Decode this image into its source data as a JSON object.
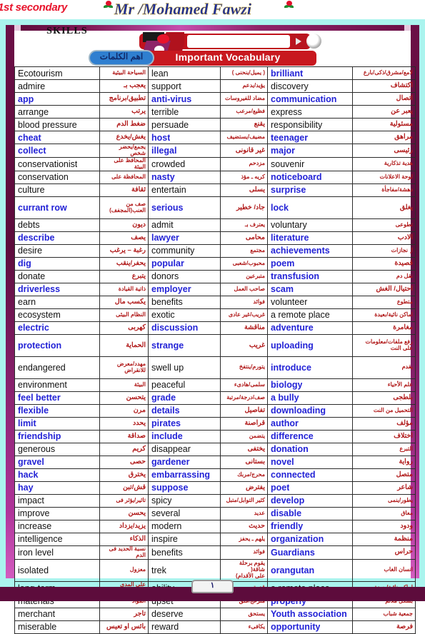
{
  "header": {
    "grade_label": "1st secondary",
    "teacher_name": "Mr /Mohamed Fawzi",
    "skills_label": "SKILLS",
    "vocabulary_label": "Important Vocabulary",
    "vocabulary_label_arabic": "اهم الكلمات"
  },
  "footer": {
    "page_number": "١"
  },
  "colors": {
    "english_blue": "#2323d6",
    "english_black": "#111111",
    "arabic_red": "#b01818",
    "banner_red": "#c8181f",
    "frame_cyan": "#aaf4ee",
    "band_purple": "#5d0c3c",
    "grade_red": "#e8142c",
    "teacher_blue": "#1d2f9e"
  },
  "table": {
    "rows": [
      {
        "h": "s",
        "c1": {
          "en": "Ecotourism",
          "style": "black",
          "ar": "السياحة البيئية",
          "ar_size": "tiny"
        },
        "c2": {
          "en": "lean",
          "style": "black",
          "ar": "( يميل/ينحنى )",
          "ar_size": "tiny"
        },
        "c3": {
          "en": "brilliant",
          "style": "blue",
          "ar": "لامع/مشرق/ذكى/بارع",
          "ar_size": "tiny"
        }
      },
      {
        "h": "s",
        "c1": {
          "en": "admire",
          "style": "black",
          "ar": "يعجب بـ",
          "ar_size": ""
        },
        "c2": {
          "en": "support",
          "style": "black",
          "ar": "يؤيد/يدعم",
          "ar_size": "tiny"
        },
        "c3": {
          "en": "discovery",
          "style": "black",
          "ar": "اكتشاف",
          "ar_size": ""
        }
      },
      {
        "h": "s",
        "c1": {
          "en": "app",
          "style": "blue",
          "ar": "تطبيق/برنامج",
          "ar_size": ""
        },
        "c2": {
          "en": "anti-virus",
          "style": "blue",
          "ar": "مضاد للفيروسات",
          "ar_size": "tiny"
        },
        "c3": {
          "en": "communication",
          "style": "blue",
          "ar": "اتصال",
          "ar_size": ""
        }
      },
      {
        "h": "s",
        "c1": {
          "en": "arrange",
          "style": "black",
          "ar": "يرتب",
          "ar_size": ""
        },
        "c2": {
          "en": "terrible",
          "style": "black",
          "ar": "فظيع/مرعب",
          "ar_size": "tiny"
        },
        "c3": {
          "en": "express",
          "style": "black",
          "ar": "يعبر عن",
          "ar_size": ""
        }
      },
      {
        "h": "s",
        "c1": {
          "en": "blood pressure",
          "style": "black",
          "ar": "ضغط الدم",
          "ar_size": ""
        },
        "c2": {
          "en": "persuade",
          "style": "black",
          "ar": "يقنع",
          "ar_size": ""
        },
        "c3": {
          "en": "responsibility",
          "style": "black",
          "ar": "مسئولية",
          "ar_size": ""
        }
      },
      {
        "h": "s",
        "c1": {
          "en": "cheat",
          "style": "blue",
          "ar": "يغش/يخدع",
          "ar_size": ""
        },
        "c2": {
          "en": "host",
          "style": "blue",
          "ar": "مضيف/يستضيف",
          "ar_size": "tiny"
        },
        "c3": {
          "en": "teenager",
          "style": "blue",
          "ar": "مراهق",
          "ar_size": ""
        }
      },
      {
        "h": "s",
        "c1": {
          "en": "collect",
          "style": "blue",
          "ar": "يجمع/يحضر شخص",
          "ar_size": "tiny"
        },
        "c2": {
          "en": "illegal",
          "style": "blue",
          "ar": "غير قانونى",
          "ar_size": ""
        },
        "c3": {
          "en": "major",
          "style": "blue",
          "ar": "رئيسى",
          "ar_size": ""
        }
      },
      {
        "h": "s",
        "c1": {
          "en": "conservationist",
          "style": "black",
          "ar": "المحافظ على البيئة",
          "ar_size": "tiny"
        },
        "c2": {
          "en": "crowded",
          "style": "black",
          "ar": "مزدحم",
          "ar_size": "tiny"
        },
        "c3": {
          "en": "souvenir",
          "style": "black",
          "ar": "هدية تذكارية",
          "ar_size": "tiny"
        }
      },
      {
        "h": "s",
        "c1": {
          "en": "conservation",
          "style": "black",
          "ar": "المحافظة على",
          "ar_size": "tiny"
        },
        "c2": {
          "en": "nasty",
          "style": "blue",
          "ar": "كريه ـ مؤذ",
          "ar_size": "tiny"
        },
        "c3": {
          "en": "noticeboard",
          "style": "blue",
          "ar": "لوحة الاعلانات",
          "ar_size": "tiny"
        }
      },
      {
        "h": "s",
        "c1": {
          "en": "culture",
          "style": "black",
          "ar": "ثقافة",
          "ar_size": ""
        },
        "c2": {
          "en": "entertain",
          "style": "black",
          "ar": "يسلى",
          "ar_size": ""
        },
        "c3": {
          "en": "surprise",
          "style": "blue",
          "ar": "دهشة/مفاجأة",
          "ar_size": "tiny"
        }
      },
      {
        "h": "t",
        "c1": {
          "en": "currant row",
          "style": "blue",
          "ar": "صف من\nالعنب(المجفف)",
          "ar_size": "tiny"
        },
        "c2": {
          "en": "serious",
          "style": "blue",
          "ar": "جاد/ خطير",
          "ar_size": ""
        },
        "c3": {
          "en": "lock",
          "style": "blue",
          "ar": "يغلق",
          "ar_size": ""
        }
      },
      {
        "h": "s",
        "c1": {
          "en": "debts",
          "style": "black",
          "ar": "ديون",
          "ar_size": ""
        },
        "c2": {
          "en": "admit",
          "style": "black",
          "ar": "يعترف بـ",
          "ar_size": "tiny"
        },
        "c3": {
          "en": "voluntary",
          "style": "black",
          "ar": "تطوعى",
          "ar_size": "tiny"
        }
      },
      {
        "h": "s",
        "c1": {
          "en": "describe",
          "style": "blue",
          "ar": "يصف",
          "ar_size": ""
        },
        "c2": {
          "en": "lawyer",
          "style": "blue",
          "ar": "محامى",
          "ar_size": ""
        },
        "c3": {
          "en": "literature",
          "style": "blue",
          "ar": "الادب",
          "ar_size": ""
        }
      },
      {
        "h": "s",
        "c1": {
          "en": "desire",
          "style": "black",
          "ar": "رغبة – يرغب",
          "ar_size": ""
        },
        "c2": {
          "en": "community",
          "style": "black",
          "ar": "مجتمع",
          "ar_size": "tiny"
        },
        "c3": {
          "en": "achievements",
          "style": "blue",
          "ar": "ا ٕ نجازات",
          "ar_size": "tiny"
        }
      },
      {
        "h": "s",
        "c1": {
          "en": "dig",
          "style": "blue",
          "ar": "يحفر/ينقب",
          "ar_size": ""
        },
        "c2": {
          "en": "popular",
          "style": "blue",
          "ar": "محبوب/شعبى",
          "ar_size": "tiny"
        },
        "c3": {
          "en": "poem",
          "style": "blue",
          "ar": "قصيدة",
          "ar_size": ""
        }
      },
      {
        "h": "s",
        "c1": {
          "en": "donate",
          "style": "black",
          "ar": "يتبرع",
          "ar_size": ""
        },
        "c2": {
          "en": "donors",
          "style": "black",
          "ar": "متبرعين",
          "ar_size": "tiny"
        },
        "c3": {
          "en": "transfusion",
          "style": "blue",
          "ar": "نقل دم",
          "ar_size": "tiny"
        }
      },
      {
        "h": "s",
        "c1": {
          "en": "driverless",
          "style": "blue",
          "ar": "ذاتية القيادة",
          "ar_size": "tiny"
        },
        "c2": {
          "en": "employer",
          "style": "blue",
          "ar": "صاحب العمل",
          "ar_size": "tiny"
        },
        "c3": {
          "en": "scam",
          "style": "blue",
          "ar": "احتيال/ الغش",
          "ar_size": ""
        }
      },
      {
        "h": "s",
        "c1": {
          "en": "earn",
          "style": "black",
          "ar": "يكسب مال",
          "ar_size": ""
        },
        "c2": {
          "en": "benefits",
          "style": "black",
          "ar": "فوائد",
          "ar_size": "tiny"
        },
        "c3": {
          "en": "volunteer",
          "style": "black",
          "ar": "متطوع",
          "ar_size": "tiny"
        }
      },
      {
        "h": "s",
        "c1": {
          "en": "ecosystem",
          "style": "black",
          "ar": "النظام البيئى",
          "ar_size": "tiny"
        },
        "c2": {
          "en": "exotic",
          "style": "black",
          "ar": "غريب/غير عادى",
          "ar_size": "tiny"
        },
        "c3": {
          "en": "a remote place",
          "style": "black",
          "ar": "اماكن نائية/بعيدة",
          "ar_size": "tiny"
        }
      },
      {
        "h": "s",
        "c1": {
          "en": "electric",
          "style": "blue",
          "ar": "كهربى",
          "ar_size": ""
        },
        "c2": {
          "en": "discussion",
          "style": "blue",
          "ar": "مناقشة",
          "ar_size": ""
        },
        "c3": {
          "en": "adventure",
          "style": "blue",
          "ar": "مغامرة",
          "ar_size": ""
        }
      },
      {
        "h": "t",
        "c1": {
          "en": "protection",
          "style": "blue",
          "ar": "الحماية",
          "ar_size": ""
        },
        "c2": {
          "en": "strange",
          "style": "blue",
          "ar": "غريب",
          "ar_size": ""
        },
        "c3": {
          "en": "uploading",
          "style": "blue",
          "ar": "رفع ملفات/معلومات\nعلى النت",
          "ar_size": "tiny"
        }
      },
      {
        "h": "t",
        "c1": {
          "en": "endangered",
          "style": "black",
          "ar": "مهدد/معرض\nللانقراض",
          "ar_size": "tiny"
        },
        "c2": {
          "en": "swell up",
          "style": "black",
          "ar": "يتورم/ينتفخ",
          "ar_size": "tiny"
        },
        "c3": {
          "en": "introduce",
          "style": "blue",
          "ar": "يقدم",
          "ar_size": "tiny"
        }
      },
      {
        "h": "s",
        "c1": {
          "en": "environment",
          "style": "black",
          "ar": "البيئة",
          "ar_size": "tiny"
        },
        "c2": {
          "en": "peaceful",
          "style": "black",
          "ar": "سلمى/هادىء",
          "ar_size": "tiny"
        },
        "c3": {
          "en": "biology",
          "style": "blue",
          "ar": "علم الأحياء",
          "ar_size": "tiny"
        }
      },
      {
        "h": "s",
        "c1": {
          "en": "feel better",
          "style": "blue",
          "ar": "يتحسن",
          "ar_size": ""
        },
        "c2": {
          "en": "grade",
          "style": "blue",
          "ar": "صف/درجة/مرتبة",
          "ar_size": "tiny"
        },
        "c3": {
          "en": "a bully",
          "style": "blue",
          "ar": "بلطجى",
          "ar_size": ""
        }
      },
      {
        "h": "s",
        "c1": {
          "en": "flexible",
          "style": "blue",
          "ar": "مرن",
          "ar_size": ""
        },
        "c2": {
          "en": "details",
          "style": "blue",
          "ar": "تفاصيل",
          "ar_size": ""
        },
        "c3": {
          "en": "downloading",
          "style": "blue",
          "ar": "التحميل من النت",
          "ar_size": "tiny"
        }
      },
      {
        "h": "s",
        "c1": {
          "en": "limit",
          "style": "blue",
          "ar": "يحدد",
          "ar_size": ""
        },
        "c2": {
          "en": "pirates",
          "style": "blue",
          "ar": "قراصنة",
          "ar_size": ""
        },
        "c3": {
          "en": "author",
          "style": "blue",
          "ar": "مؤلف",
          "ar_size": ""
        }
      },
      {
        "h": "s",
        "c1": {
          "en": "friendship",
          "style": "blue",
          "ar": "صداقة",
          "ar_size": ""
        },
        "c2": {
          "en": "include",
          "style": "blue",
          "ar": "يتضمن",
          "ar_size": "tiny"
        },
        "c3": {
          "en": "difference",
          "style": "blue",
          "ar": "اختلاف",
          "ar_size": ""
        }
      },
      {
        "h": "s",
        "c1": {
          "en": "generous",
          "style": "black",
          "ar": "كريم",
          "ar_size": ""
        },
        "c2": {
          "en": "disappear",
          "style": "black",
          "ar": "يختفى",
          "ar_size": ""
        },
        "c3": {
          "en": "donation",
          "style": "blue",
          "ar": "التبرع",
          "ar_size": "tiny"
        }
      },
      {
        "h": "s",
        "c1": {
          "en": "gravel",
          "style": "blue",
          "ar": "حصى",
          "ar_size": ""
        },
        "c2": {
          "en": "gardener",
          "style": "blue",
          "ar": "بستانى",
          "ar_size": ""
        },
        "c3": {
          "en": "novel",
          "style": "blue",
          "ar": "رواية",
          "ar_size": ""
        }
      },
      {
        "h": "s",
        "c1": {
          "en": "hack",
          "style": "blue",
          "ar": "يخترق",
          "ar_size": ""
        },
        "c2": {
          "en": "embarrassing",
          "style": "blue",
          "ar": "محرج/مربك",
          "ar_size": "tiny"
        },
        "c3": {
          "en": "connected",
          "style": "blue",
          "ar": "متصل",
          "ar_size": ""
        }
      },
      {
        "h": "s",
        "c1": {
          "en": "hay",
          "style": "blue",
          "ar": "قش/تبن",
          "ar_size": ""
        },
        "c2": {
          "en": "suppose",
          "style": "blue",
          "ar": "يفترض",
          "ar_size": ""
        },
        "c3": {
          "en": "poet",
          "style": "blue",
          "ar": "شاعر",
          "ar_size": ""
        }
      },
      {
        "h": "s",
        "c1": {
          "en": "impact",
          "style": "black",
          "ar": "تاثير/يؤثر فى",
          "ar_size": "tiny"
        },
        "c2": {
          "en": "spicy",
          "style": "black",
          "ar": "كثير التوابل/متبل",
          "ar_size": "tiny"
        },
        "c3": {
          "en": "develop",
          "style": "blue",
          "ar": "يطور/ينمى",
          "ar_size": "tiny"
        }
      },
      {
        "h": "s",
        "c1": {
          "en": "improve",
          "style": "black",
          "ar": "يحسن",
          "ar_size": ""
        },
        "c2": {
          "en": "several",
          "style": "black",
          "ar": "عديد",
          "ar_size": "tiny"
        },
        "c3": {
          "en": "disable",
          "style": "blue",
          "ar": "معاق",
          "ar_size": "tiny"
        }
      },
      {
        "h": "s",
        "c1": {
          "en": "increase",
          "style": "black",
          "ar": "يزيد/يزداد",
          "ar_size": ""
        },
        "c2": {
          "en": "modern",
          "style": "black",
          "ar": "حديث",
          "ar_size": ""
        },
        "c3": {
          "en": "friendly",
          "style": "blue",
          "ar": "ودود",
          "ar_size": ""
        }
      },
      {
        "h": "s",
        "c1": {
          "en": "intelligence",
          "style": "black",
          "ar": "الذكاء",
          "ar_size": ""
        },
        "c2": {
          "en": "inspire",
          "style": "black",
          "ar": "يلهم ـ يحفز",
          "ar_size": "tiny"
        },
        "c3": {
          "en": "organization",
          "style": "blue",
          "ar": "منظمة",
          "ar_size": ""
        }
      },
      {
        "h": "s",
        "c1": {
          "en": "iron level",
          "style": "black",
          "ar": "نسبة الحديد فى الدم",
          "ar_size": "tiny"
        },
        "c2": {
          "en": "benefits",
          "style": "black",
          "ar": "فوائد",
          "ar_size": "tiny"
        },
        "c3": {
          "en": "Guardians",
          "style": "blue",
          "ar": "حراس",
          "ar_size": ""
        }
      },
      {
        "h": "t",
        "c1": {
          "en": "isolated",
          "style": "black",
          "ar": "معزول",
          "ar_size": "tiny"
        },
        "c2": {
          "en": "trek",
          "style": "black",
          "ar": "يقوم برحلة شاقة(\nعلى الأقدام)",
          "ar_size": "tiny"
        },
        "c3": {
          "en": "orangutan",
          "style": "blue",
          "ar": "انسان الغاب",
          "ar_size": "tiny"
        }
      },
      {
        "h": "s",
        "c1": {
          "en": "long-term",
          "style": "black",
          "ar": "على المدى الطويل",
          "ar_size": "tiny"
        },
        "c2": {
          "en": "ability",
          "style": "black",
          "ar": "قدرة",
          "ar_size": "tiny"
        },
        "c3": {
          "en": "a remote place",
          "style": "black",
          "ar": "اماكن نائية/بعيدة",
          "ar_size": "tiny"
        }
      },
      {
        "h": "s",
        "c1": {
          "en": "materials",
          "style": "black",
          "ar": "المواد",
          "ar_size": "tiny"
        },
        "c2": {
          "en": "upset",
          "style": "black",
          "ar": "منزعج/قلق",
          "ar_size": "tiny"
        },
        "c3": {
          "en": "properly",
          "style": "blue",
          "ar": "بشكل ملائم",
          "ar_size": "tiny"
        }
      },
      {
        "h": "s",
        "c1": {
          "en": "merchant",
          "style": "black",
          "ar": "تاجر",
          "ar_size": ""
        },
        "c2": {
          "en": "deserve",
          "style": "black",
          "ar": "يستحق",
          "ar_size": "tiny"
        },
        "c3": {
          "en": "Youth association",
          "style": "blue",
          "ar": "جمعية شباب",
          "ar_size": "tiny"
        }
      },
      {
        "h": "s",
        "c1": {
          "en": "miserable",
          "style": "black",
          "ar": "بائس او تعيس",
          "ar_size": ""
        },
        "c2": {
          "en": "reward",
          "style": "black",
          "ar": "يكافىء",
          "ar_size": "tiny"
        },
        "c3": {
          "en": "opportunity",
          "style": "blue",
          "ar": "فرصة",
          "ar_size": ""
        }
      }
    ]
  }
}
